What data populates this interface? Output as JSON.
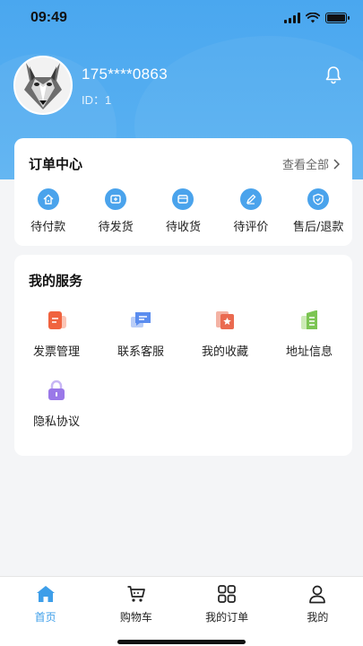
{
  "status_bar": {
    "time": "09:49"
  },
  "profile": {
    "phone": "175****0863",
    "id_text": "ID：1"
  },
  "order_center": {
    "title": "订单中心",
    "view_all": "查看全部",
    "items": [
      {
        "label": "待付款",
        "icon": "pay-icon"
      },
      {
        "label": "待发货",
        "icon": "ship-icon"
      },
      {
        "label": "待收货",
        "icon": "receive-icon"
      },
      {
        "label": "待评价",
        "icon": "review-icon"
      },
      {
        "label": "售后/退款",
        "icon": "refund-icon"
      }
    ]
  },
  "services": {
    "title": "我的服务",
    "items": [
      {
        "label": "发票管理",
        "icon": "invoice-icon",
        "color": "#f0633f"
      },
      {
        "label": "联系客服",
        "icon": "chat-icon",
        "color": "#5b8def"
      },
      {
        "label": "我的收藏",
        "icon": "favorite-icon",
        "color": "#ea6a50"
      },
      {
        "label": "地址信息",
        "icon": "address-icon",
        "color": "#7cc553"
      },
      {
        "label": "隐私协议",
        "icon": "lock-icon",
        "color": "#9a78e8"
      }
    ]
  },
  "tabs": [
    {
      "label": "首页",
      "icon": "home-icon",
      "active": true
    },
    {
      "label": "购物车",
      "icon": "cart-icon",
      "active": false
    },
    {
      "label": "我的订单",
      "icon": "orders-grid-icon",
      "active": false
    },
    {
      "label": "我的",
      "icon": "user-icon",
      "active": false
    }
  ],
  "colors": {
    "accent": "#3d9ee9",
    "header": "#4aa7ef"
  }
}
